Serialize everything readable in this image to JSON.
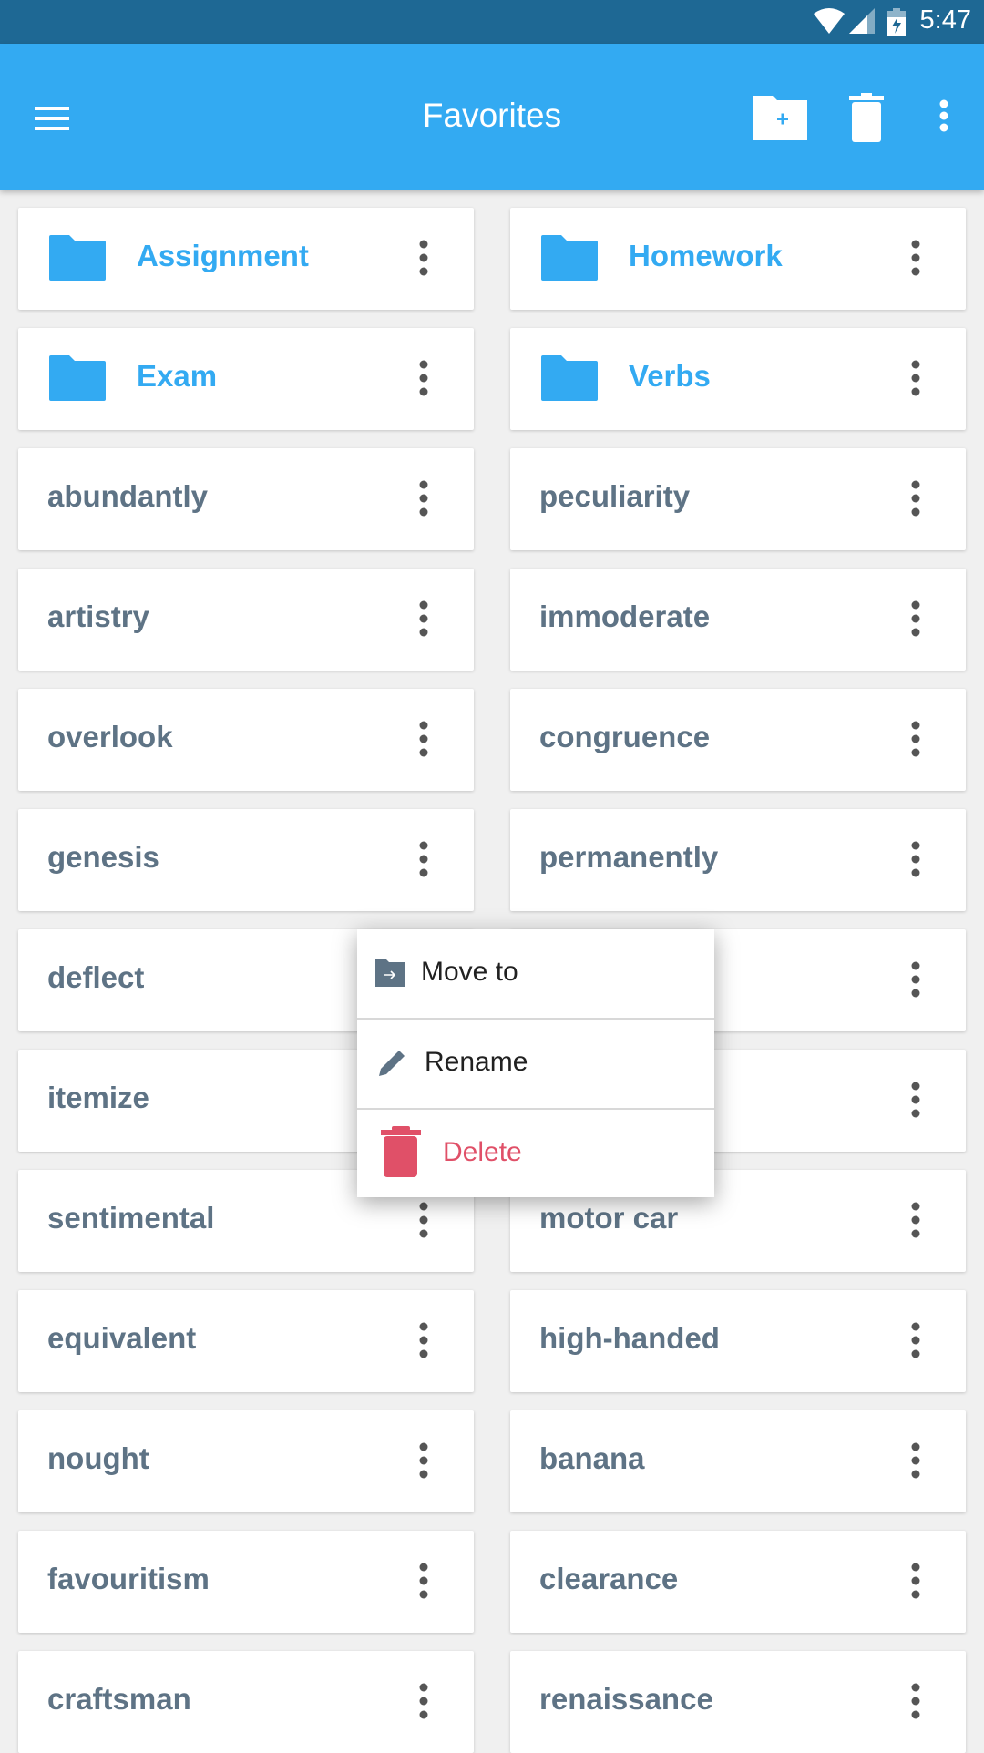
{
  "status_bar": {
    "time": "5:47",
    "icons": [
      "wifi-icon",
      "signal-icon",
      "battery-charging-icon"
    ]
  },
  "toolbar": {
    "title": "Favorites",
    "menu_icon": "hamburger-menu-icon",
    "actions": [
      "new-folder-icon",
      "trash-icon",
      "more-vert-icon"
    ]
  },
  "colors": {
    "accent": "#33aaf2",
    "status_bar": "#1e6894",
    "word_text": "#5e7385",
    "delete": "#e05068"
  },
  "items": [
    [
      {
        "label": "Assignment",
        "folder": true
      },
      {
        "label": "Homework",
        "folder": true
      }
    ],
    [
      {
        "label": "Exam",
        "folder": true
      },
      {
        "label": "Verbs",
        "folder": true
      }
    ],
    [
      {
        "label": "abundantly"
      },
      {
        "label": "peculiarity"
      }
    ],
    [
      {
        "label": "artistry"
      },
      {
        "label": "immoderate"
      }
    ],
    [
      {
        "label": "overlook"
      },
      {
        "label": "congruence"
      }
    ],
    [
      {
        "label": "genesis"
      },
      {
        "label": "permanently"
      }
    ],
    [
      {
        "label": "deflect"
      },
      {
        "label": ""
      }
    ],
    [
      {
        "label": "itemize"
      },
      {
        "label": ""
      }
    ],
    [
      {
        "label": "sentimental"
      },
      {
        "label": "motor car"
      }
    ],
    [
      {
        "label": "equivalent"
      },
      {
        "label": "high-handed"
      }
    ],
    [
      {
        "label": "nought"
      },
      {
        "label": "banana"
      }
    ],
    [
      {
        "label": "favouritism"
      },
      {
        "label": "clearance"
      }
    ],
    [
      {
        "label": "craftsman"
      },
      {
        "label": "renaissance"
      }
    ]
  ],
  "context_menu": {
    "move_to": "Move to",
    "rename": "Rename",
    "delete": "Delete"
  }
}
